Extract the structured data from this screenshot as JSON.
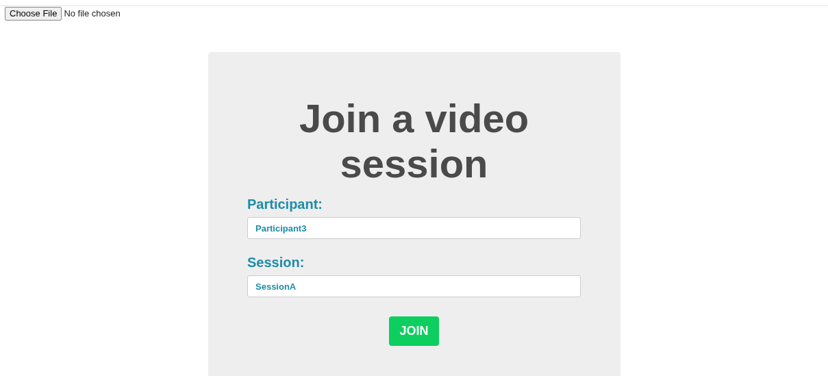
{
  "file_input": {
    "button": "Choose File",
    "status": "No file chosen"
  },
  "card": {
    "title": "Join a video session",
    "fields": [
      {
        "label": "Participant:",
        "value": "Participant3"
      },
      {
        "label": "Session:",
        "value": "SessionA"
      }
    ],
    "button": "JOIN"
  }
}
